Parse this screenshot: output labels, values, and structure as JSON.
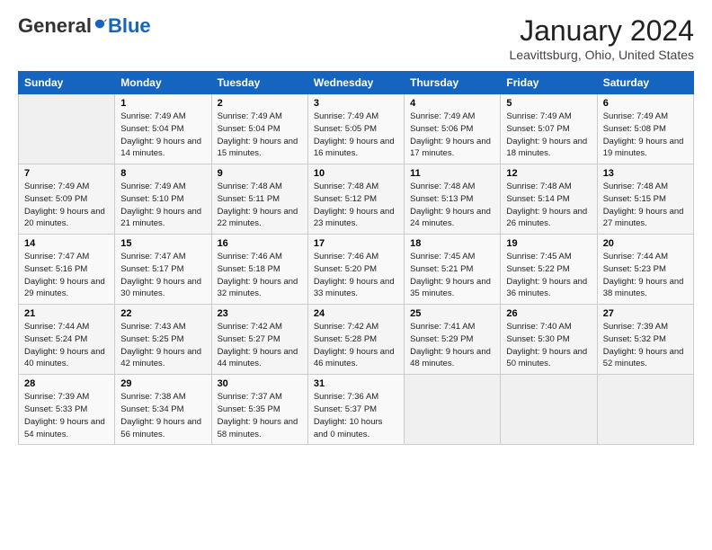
{
  "header": {
    "logo_general": "General",
    "logo_blue": "Blue",
    "month": "January 2024",
    "location": "Leavittsburg, Ohio, United States"
  },
  "weekdays": [
    "Sunday",
    "Monday",
    "Tuesday",
    "Wednesday",
    "Thursday",
    "Friday",
    "Saturday"
  ],
  "weeks": [
    [
      {
        "day": "",
        "empty": true
      },
      {
        "day": "1",
        "sunrise": "Sunrise: 7:49 AM",
        "sunset": "Sunset: 5:04 PM",
        "daylight": "Daylight: 9 hours and 14 minutes."
      },
      {
        "day": "2",
        "sunrise": "Sunrise: 7:49 AM",
        "sunset": "Sunset: 5:04 PM",
        "daylight": "Daylight: 9 hours and 15 minutes."
      },
      {
        "day": "3",
        "sunrise": "Sunrise: 7:49 AM",
        "sunset": "Sunset: 5:05 PM",
        "daylight": "Daylight: 9 hours and 16 minutes."
      },
      {
        "day": "4",
        "sunrise": "Sunrise: 7:49 AM",
        "sunset": "Sunset: 5:06 PM",
        "daylight": "Daylight: 9 hours and 17 minutes."
      },
      {
        "day": "5",
        "sunrise": "Sunrise: 7:49 AM",
        "sunset": "Sunset: 5:07 PM",
        "daylight": "Daylight: 9 hours and 18 minutes."
      },
      {
        "day": "6",
        "sunrise": "Sunrise: 7:49 AM",
        "sunset": "Sunset: 5:08 PM",
        "daylight": "Daylight: 9 hours and 19 minutes."
      }
    ],
    [
      {
        "day": "7",
        "sunrise": "Sunrise: 7:49 AM",
        "sunset": "Sunset: 5:09 PM",
        "daylight": "Daylight: 9 hours and 20 minutes."
      },
      {
        "day": "8",
        "sunrise": "Sunrise: 7:49 AM",
        "sunset": "Sunset: 5:10 PM",
        "daylight": "Daylight: 9 hours and 21 minutes."
      },
      {
        "day": "9",
        "sunrise": "Sunrise: 7:48 AM",
        "sunset": "Sunset: 5:11 PM",
        "daylight": "Daylight: 9 hours and 22 minutes."
      },
      {
        "day": "10",
        "sunrise": "Sunrise: 7:48 AM",
        "sunset": "Sunset: 5:12 PM",
        "daylight": "Daylight: 9 hours and 23 minutes."
      },
      {
        "day": "11",
        "sunrise": "Sunrise: 7:48 AM",
        "sunset": "Sunset: 5:13 PM",
        "daylight": "Daylight: 9 hours and 24 minutes."
      },
      {
        "day": "12",
        "sunrise": "Sunrise: 7:48 AM",
        "sunset": "Sunset: 5:14 PM",
        "daylight": "Daylight: 9 hours and 26 minutes."
      },
      {
        "day": "13",
        "sunrise": "Sunrise: 7:48 AM",
        "sunset": "Sunset: 5:15 PM",
        "daylight": "Daylight: 9 hours and 27 minutes."
      }
    ],
    [
      {
        "day": "14",
        "sunrise": "Sunrise: 7:47 AM",
        "sunset": "Sunset: 5:16 PM",
        "daylight": "Daylight: 9 hours and 29 minutes."
      },
      {
        "day": "15",
        "sunrise": "Sunrise: 7:47 AM",
        "sunset": "Sunset: 5:17 PM",
        "daylight": "Daylight: 9 hours and 30 minutes."
      },
      {
        "day": "16",
        "sunrise": "Sunrise: 7:46 AM",
        "sunset": "Sunset: 5:18 PM",
        "daylight": "Daylight: 9 hours and 32 minutes."
      },
      {
        "day": "17",
        "sunrise": "Sunrise: 7:46 AM",
        "sunset": "Sunset: 5:20 PM",
        "daylight": "Daylight: 9 hours and 33 minutes."
      },
      {
        "day": "18",
        "sunrise": "Sunrise: 7:45 AM",
        "sunset": "Sunset: 5:21 PM",
        "daylight": "Daylight: 9 hours and 35 minutes."
      },
      {
        "day": "19",
        "sunrise": "Sunrise: 7:45 AM",
        "sunset": "Sunset: 5:22 PM",
        "daylight": "Daylight: 9 hours and 36 minutes."
      },
      {
        "day": "20",
        "sunrise": "Sunrise: 7:44 AM",
        "sunset": "Sunset: 5:23 PM",
        "daylight": "Daylight: 9 hours and 38 minutes."
      }
    ],
    [
      {
        "day": "21",
        "sunrise": "Sunrise: 7:44 AM",
        "sunset": "Sunset: 5:24 PM",
        "daylight": "Daylight: 9 hours and 40 minutes."
      },
      {
        "day": "22",
        "sunrise": "Sunrise: 7:43 AM",
        "sunset": "Sunset: 5:25 PM",
        "daylight": "Daylight: 9 hours and 42 minutes."
      },
      {
        "day": "23",
        "sunrise": "Sunrise: 7:42 AM",
        "sunset": "Sunset: 5:27 PM",
        "daylight": "Daylight: 9 hours and 44 minutes."
      },
      {
        "day": "24",
        "sunrise": "Sunrise: 7:42 AM",
        "sunset": "Sunset: 5:28 PM",
        "daylight": "Daylight: 9 hours and 46 minutes."
      },
      {
        "day": "25",
        "sunrise": "Sunrise: 7:41 AM",
        "sunset": "Sunset: 5:29 PM",
        "daylight": "Daylight: 9 hours and 48 minutes."
      },
      {
        "day": "26",
        "sunrise": "Sunrise: 7:40 AM",
        "sunset": "Sunset: 5:30 PM",
        "daylight": "Daylight: 9 hours and 50 minutes."
      },
      {
        "day": "27",
        "sunrise": "Sunrise: 7:39 AM",
        "sunset": "Sunset: 5:32 PM",
        "daylight": "Daylight: 9 hours and 52 minutes."
      }
    ],
    [
      {
        "day": "28",
        "sunrise": "Sunrise: 7:39 AM",
        "sunset": "Sunset: 5:33 PM",
        "daylight": "Daylight: 9 hours and 54 minutes."
      },
      {
        "day": "29",
        "sunrise": "Sunrise: 7:38 AM",
        "sunset": "Sunset: 5:34 PM",
        "daylight": "Daylight: 9 hours and 56 minutes."
      },
      {
        "day": "30",
        "sunrise": "Sunrise: 7:37 AM",
        "sunset": "Sunset: 5:35 PM",
        "daylight": "Daylight: 9 hours and 58 minutes."
      },
      {
        "day": "31",
        "sunrise": "Sunrise: 7:36 AM",
        "sunset": "Sunset: 5:37 PM",
        "daylight": "Daylight: 10 hours and 0 minutes."
      },
      {
        "day": "",
        "empty": true
      },
      {
        "day": "",
        "empty": true
      },
      {
        "day": "",
        "empty": true
      }
    ]
  ]
}
